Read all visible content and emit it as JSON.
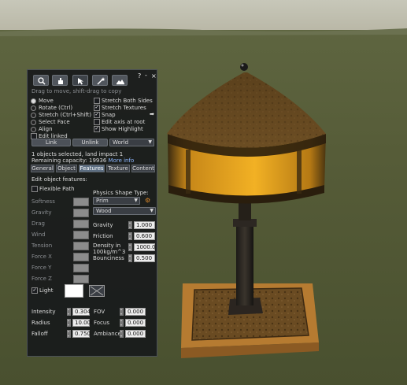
{
  "toolbar": {
    "tools": [
      "focus-tool",
      "move-tool",
      "edit-tool",
      "create-tool",
      "land-tool"
    ],
    "help": "?",
    "minimize": "-",
    "close": "×"
  },
  "hint": "Drag to move, shift-drag to copy",
  "edit_options": {
    "left": [
      {
        "label": "Move",
        "type": "radio",
        "on": true
      },
      {
        "label": "Rotate (Ctrl)",
        "type": "radio",
        "on": false
      },
      {
        "label": "Stretch (Ctrl+Shift)",
        "type": "radio",
        "on": false
      },
      {
        "label": "Select Face",
        "type": "radio",
        "on": false
      },
      {
        "label": "Align",
        "type": "radio",
        "on": false
      },
      {
        "label": "Edit linked",
        "type": "checkbox",
        "on": false
      }
    ],
    "right": [
      {
        "label": "Stretch Both Sides",
        "checked": false
      },
      {
        "label": "Stretch Textures",
        "checked": true
      },
      {
        "label": "Snap",
        "checked": true
      },
      {
        "label": "Edit axis at root",
        "checked": false
      },
      {
        "label": "Show Highlight",
        "checked": true
      }
    ]
  },
  "link_button": "Link",
  "unlink_button": "Unlink",
  "ruler_select": "World",
  "status": {
    "line1": "1 objects selected, land impact 1",
    "line2_prefix": "Remaining capacity: 19936",
    "more_info": "More info"
  },
  "tabs": [
    "General",
    "Object",
    "Features",
    "Texture",
    "Content"
  ],
  "active_tab": "Features",
  "features": {
    "section_label": "Edit object features:",
    "flexible_path": "Flexible Path",
    "flex_params": [
      "Softness",
      "Gravity",
      "Drag",
      "Wind",
      "Tension",
      "Force X",
      "Force Y",
      "Force Z"
    ],
    "physics_shape_label": "Physics Shape Type:",
    "physics_shape_value": "Prim",
    "material_value": "Wood",
    "physics": [
      {
        "label": "Gravity",
        "value": "1.000"
      },
      {
        "label": "Friction",
        "value": "0.600"
      },
      {
        "label": "Density in 100kg/m^3",
        "value": "1000.0"
      },
      {
        "label": "Bounciness",
        "value": "0.500"
      }
    ],
    "light_label": "Light",
    "light_checked": true,
    "light_color": "#ffffff",
    "light_fields_left": [
      {
        "label": "Intensity",
        "value": "0.304"
      },
      {
        "label": "Radius",
        "value": "10.000"
      },
      {
        "label": "Falloff",
        "value": "0.750"
      }
    ],
    "light_fields_right": [
      {
        "label": "FOV",
        "value": "0.000"
      },
      {
        "label": "Focus",
        "value": "0.000"
      },
      {
        "label": "Ambiance",
        "value": "0.000"
      }
    ]
  }
}
